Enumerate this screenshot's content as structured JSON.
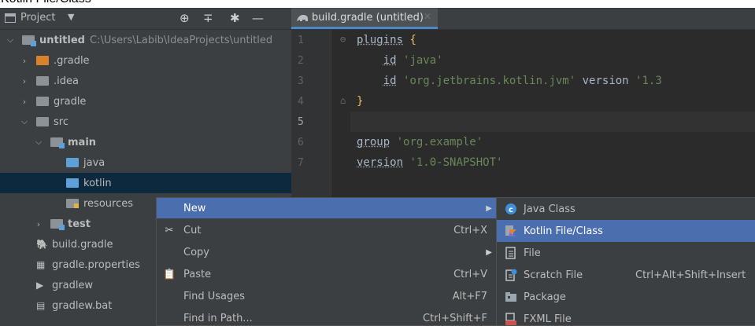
{
  "caption": "Kotlin File/Class",
  "project_panel": {
    "title": "Project",
    "tree": [
      {
        "label": "untitled",
        "path": "C:\\Users\\Labib\\IdeaProjects\\untitled",
        "bold": true,
        "icon": "module-folder-icon",
        "chevron": "expanded"
      },
      {
        "label": ".gradle",
        "icon": "folder-orange-icon",
        "chevron": "collapsed"
      },
      {
        "label": ".idea",
        "icon": "folder-icon",
        "chevron": "collapsed"
      },
      {
        "label": "gradle",
        "icon": "folder-icon",
        "chevron": "collapsed"
      },
      {
        "label": "src",
        "icon": "folder-icon",
        "chevron": "expanded"
      },
      {
        "label": "main",
        "bold": true,
        "icon": "module-folder-icon",
        "chevron": "expanded"
      },
      {
        "label": "java",
        "icon": "source-folder-icon"
      },
      {
        "label": "kotlin",
        "icon": "source-folder-icon",
        "selected": true
      },
      {
        "label": "resources",
        "icon": "resources-folder-icon"
      },
      {
        "label": "test",
        "bold": true,
        "icon": "module-folder-icon",
        "chevron": "collapsed"
      },
      {
        "label": "build.gradle",
        "icon": "gradle-elephant-icon"
      },
      {
        "label": "gradle.properties",
        "icon": "properties-file-icon"
      },
      {
        "label": "gradlew",
        "icon": "terminal-file-icon"
      },
      {
        "label": "gradlew.bat",
        "icon": "text-file-icon"
      }
    ]
  },
  "editor": {
    "tab_title": "build.gradle (untitled)",
    "line_numbers": [
      "1",
      "2",
      "3",
      "4",
      "5",
      "6",
      "7"
    ],
    "current_line": "5",
    "lines": [
      [
        {
          "t": "plugins",
          "c": "kw"
        },
        {
          "t": " {",
          "c": "brace"
        }
      ],
      [
        {
          "t": "    ",
          "c": "plain"
        },
        {
          "t": "id",
          "c": "kw"
        },
        {
          "t": " ",
          "c": "plain"
        },
        {
          "t": "'java'",
          "c": "str"
        }
      ],
      [
        {
          "t": "    ",
          "c": "plain"
        },
        {
          "t": "id",
          "c": "kw"
        },
        {
          "t": " ",
          "c": "plain"
        },
        {
          "t": "'org.jetbrains.kotlin.jvm'",
          "c": "str"
        },
        {
          "t": " version ",
          "c": "plain"
        },
        {
          "t": "'1.3",
          "c": "str"
        }
      ],
      [
        {
          "t": "}",
          "c": "brace"
        }
      ],
      [],
      [
        {
          "t": "group",
          "c": "kw"
        },
        {
          "t": " ",
          "c": "plain"
        },
        {
          "t": "'org.example'",
          "c": "str"
        }
      ],
      [
        {
          "t": "version",
          "c": "kw"
        },
        {
          "t": " ",
          "c": "plain"
        },
        {
          "t": "'1.0-SNAPSHOT'",
          "c": "str"
        }
      ]
    ]
  },
  "context_menu": [
    {
      "label": "New",
      "icon": "",
      "shortcut": "",
      "submenu": true,
      "highlighted": true,
      "underline": ""
    },
    {
      "label": "Cut",
      "icon": "scissors-icon",
      "shortcut": "Ctrl+X",
      "submenu": false
    },
    {
      "label": "Copy",
      "icon": "",
      "shortcut": "",
      "submenu": true
    },
    {
      "label": "Paste",
      "icon": "clipboard-icon",
      "shortcut": "Ctrl+V",
      "submenu": false
    },
    {
      "label": "Find Usages",
      "icon": "",
      "shortcut": "Alt+F7",
      "submenu": false
    },
    {
      "label": "Find in Path...",
      "icon": "",
      "shortcut": "Ctrl+Shift+F",
      "submenu": false
    }
  ],
  "submenu": [
    {
      "label": "Java Class",
      "icon": "java-class-icon",
      "shortcut": ""
    },
    {
      "label": "Kotlin File/Class",
      "icon": "kotlin-file-icon",
      "shortcut": "",
      "highlighted": true
    },
    {
      "label": "File",
      "icon": "file-icon",
      "shortcut": ""
    },
    {
      "label": "Scratch File",
      "icon": "scratch-file-icon",
      "shortcut": "Ctrl+Alt+Shift+Insert"
    },
    {
      "label": "Package",
      "icon": "package-icon",
      "shortcut": ""
    },
    {
      "label": "FXML File",
      "icon": "fxml-file-icon",
      "shortcut": ""
    }
  ]
}
